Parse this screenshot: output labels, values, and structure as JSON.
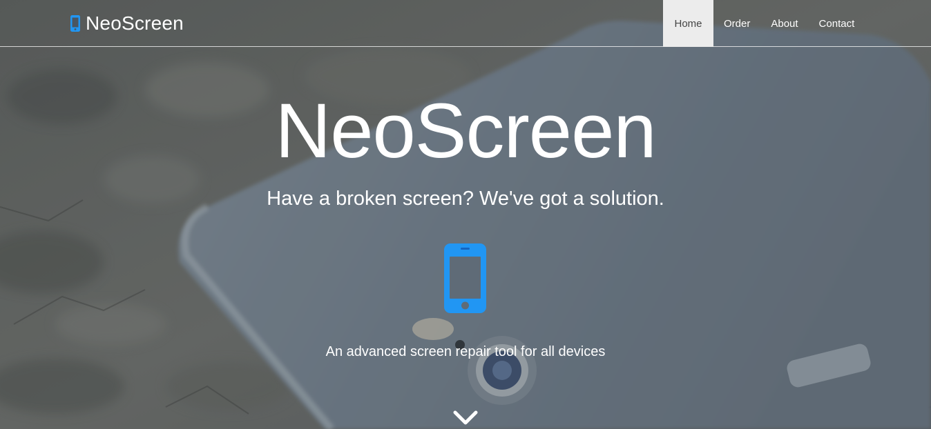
{
  "navbar": {
    "brand": {
      "light": "Neo",
      "bold": "Screen",
      "icon": "mobile-phone-icon"
    },
    "items": [
      {
        "label": "Home",
        "active": true
      },
      {
        "label": "Order",
        "active": false
      },
      {
        "label": "About",
        "active": false
      },
      {
        "label": "Contact",
        "active": false
      }
    ]
  },
  "hero": {
    "title_light": "Neo",
    "title_bold": "Screen",
    "subtitle": "Have a broken screen? We've got a solution.",
    "icon": "mobile-phone-icon",
    "tagline": "An advanced screen repair tool for all devices",
    "scroll_icon": "chevron-down-icon"
  },
  "colors": {
    "accent": "#2196f3",
    "nav_active_bg": "#ececec",
    "overlay": "#5a636b"
  }
}
